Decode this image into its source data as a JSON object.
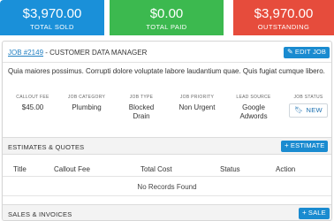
{
  "stats": {
    "total_sold": {
      "amount": "$3,970.00",
      "label": "TOTAL SOLD"
    },
    "total_paid": {
      "amount": "$0.00",
      "label": "TOTAL PAID"
    },
    "outstanding": {
      "amount": "$3,970.00",
      "label": "OUTSTANDING"
    }
  },
  "job": {
    "number": "JOB #2149",
    "title_suffix": " - CUSTOMER DATA MANAGER",
    "edit_label": "EDIT JOB",
    "description": "Quia maiores possimus. Corrupti dolore voluptate labore laudantium quae. Quis fugiat cumque libero.",
    "fields": {
      "callout_fee": {
        "label": "CALLOUT FEE",
        "value": "$45.00"
      },
      "category": {
        "label": "JOB CATEGORY",
        "value": "Plumbing"
      },
      "type": {
        "label": "JOB TYPE",
        "value": "Blocked Drain"
      },
      "priority": {
        "label": "JOB PRIORITY",
        "value": "Non Urgent"
      },
      "lead_source": {
        "label": "LEAD SOURCE",
        "value": "Google Adwords"
      },
      "status": {
        "label": "JOB STATUS",
        "value": "NEW"
      }
    }
  },
  "estimates": {
    "title": "ESTIMATES & QUOTES",
    "add_label": "ESTIMATE",
    "columns": [
      "Title",
      "Callout Fee",
      "Total Cost",
      "Status",
      "Action"
    ],
    "empty_text": "No Records Found"
  },
  "sales": {
    "title": "SALES & INVOICES",
    "add_label": "SALE"
  },
  "colors": {
    "blue": "#1a90d9",
    "green": "#3cb94f",
    "red": "#e64c3c",
    "button": "#1a8bd0"
  },
  "icons": {
    "edit": "pencil-icon",
    "add": "plus-icon",
    "status": "bookmark-icon"
  }
}
